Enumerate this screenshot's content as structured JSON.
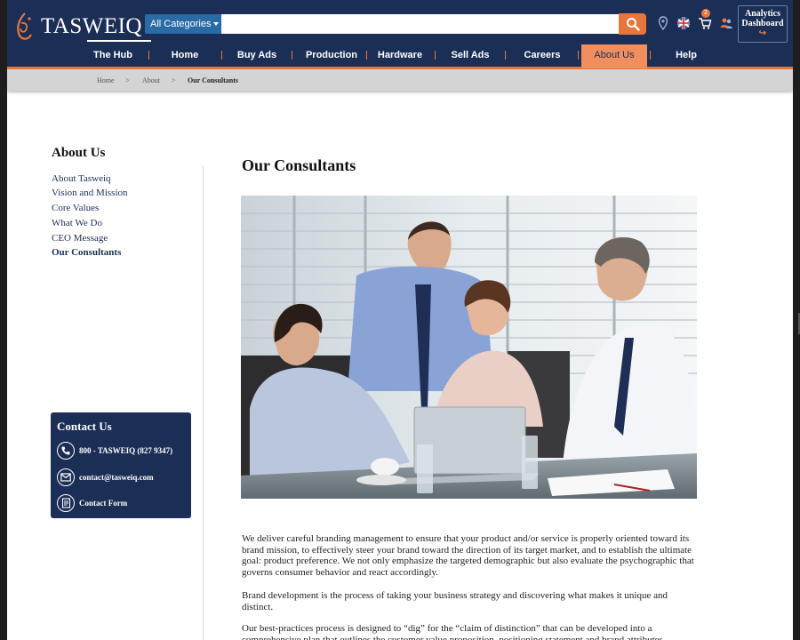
{
  "header": {
    "logo_text": "TASWEIQ",
    "category_select": "All Categories",
    "search_placeholder": "",
    "cart_count": "2",
    "analytics_label_1": "Analytics",
    "analytics_label_2": "Dashboard",
    "analytics_arrow": "↪"
  },
  "nav": {
    "items": [
      "The Hub",
      "Home",
      "Buy Ads",
      "Production",
      "Hardware",
      "Sell Ads",
      "Careers",
      "About Us",
      "Help"
    ],
    "active": "About Us"
  },
  "breadcrumb": {
    "items": [
      "Home",
      "About",
      "Our Consultants"
    ],
    "separator": ">"
  },
  "sidebar": {
    "title": "About Us",
    "links": [
      "About Tasweiq",
      "Vision and Mission",
      "Core Values",
      "What We Do",
      "CEO Message",
      "Our Consultants"
    ],
    "current": "Our Consultants"
  },
  "contact": {
    "title": "Contact Us",
    "phone": "800 - TASWEIQ (827 9347)",
    "email": "contact@tasweiq.com",
    "form": "Contact Form"
  },
  "main": {
    "title": "Our Consultants",
    "paragraphs": [
      "We deliver careful branding management to ensure that your product and/or service is properly oriented toward its brand mission, to effectively steer your brand toward the direction of its target market, and to establish the ultimate goal: product preference. We not only emphasize the targeted demographic but also evaluate the psychographic that governs consumer behavior and react accordingly.",
      "Brand development is the process of taking your business strategy and discovering what makes it unique and distinct.",
      "Our best-practices process is designed to “dig” for the “claim of distinction” that can be developed into a comprehensive plan that outlines the customer value proposition, positioning statement and brand attributes."
    ]
  },
  "colors": {
    "navy": "#1b2e55",
    "orange": "#e8763a",
    "active_tab": "#f08f5d",
    "select_blue": "#2a6ba6"
  }
}
